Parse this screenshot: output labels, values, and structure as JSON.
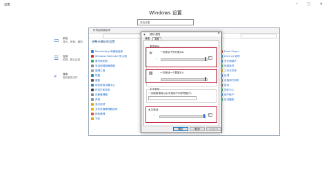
{
  "settings": {
    "title": "设置",
    "window_controls": "─ □ ✕",
    "heading": "Windows 设置",
    "search_placeholder": "查找设置",
    "categories": [
      {
        "label": "系统",
        "desc": "显示、声音、通知",
        "icon": "laptop-icon"
      },
      {
        "label": "应用",
        "desc": "卸载、默认应用",
        "icon": "apps-icon"
      },
      {
        "label": "搜索",
        "desc": "查找我的文件",
        "icon": "search-icon"
      }
    ]
  },
  "control_panel": {
    "title": "所有控制面板项",
    "heading": "调整计算机的设置",
    "left_items": [
      {
        "label": "RemoteApp 和桌面连接",
        "color": "#3a7bd5"
      },
      {
        "label": "Windows Defender 防火墙",
        "color": "#c0392b"
      },
      {
        "label": "备份和还原",
        "color": "#27ae60"
      },
      {
        "label": "电话和调制解调器",
        "color": "#7f8c8d"
      },
      {
        "label": "管理工具",
        "color": "#95a5a6"
      },
      {
        "label": "恢复",
        "color": "#2e86c1"
      },
      {
        "label": "键盘",
        "color": "#555555"
      },
      {
        "label": "轻松使用设置中心",
        "color": "#2e86c1"
      },
      {
        "label": "任务栏和导航",
        "color": "#34495e"
      },
      {
        "label": "设备管理器",
        "color": "#7f8c8d"
      },
      {
        "label": "声音",
        "color": "#85929e"
      },
      {
        "label": "索引选项",
        "color": "#d4ac0d"
      },
      {
        "label": "文件资源管理器选项",
        "color": "#e6b800"
      },
      {
        "label": "颜色管理",
        "color": "#e74c3c"
      },
      {
        "label": "字体",
        "color": "#d4ac0d"
      }
    ],
    "right_items": [
      {
        "label": "Flash Player",
        "color": "#c0392b"
      },
      {
        "label": "Internet 选项",
        "color": "#2e86c1"
      },
      {
        "label": "安全和维护",
        "color": "#2e86c1"
      },
      {
        "label": "电源选项",
        "color": "#27ae60"
      },
      {
        "label": "工作文件夹",
        "color": "#d4ac0d"
      },
      {
        "label": "区域",
        "color": "#3a7bd5"
      },
      {
        "label": "设备和打印机",
        "color": "#7f8c8d"
      },
      {
        "label": "鼠标",
        "color": "#555555"
      },
      {
        "label": "同步中心",
        "color": "#27ae60"
      },
      {
        "label": "用户帐户",
        "color": "#2e86c1"
      },
      {
        "label": "自动播放",
        "color": "#27ae60"
      }
    ]
  },
  "dialog": {
    "title": "鼠标 属性",
    "close": "✕",
    "tabs": [
      "速度",
      "滚轮"
    ],
    "vertical_group": "垂直滚动",
    "vertical_label": "一次滚动下列行数(N):",
    "vertical_value": "3",
    "vertical_screen_label": "一次滚动一个屏幕(O)",
    "horizontal_group": "水平滚动",
    "horizontal_label": "一次倾斜滚轮以水平滚动下列字符数(T):",
    "horizontal_value": "3",
    "buttons": {
      "ok": "确定",
      "cancel": "取消",
      "apply": "应用(A)"
    },
    "accent": "#c01f3b"
  }
}
